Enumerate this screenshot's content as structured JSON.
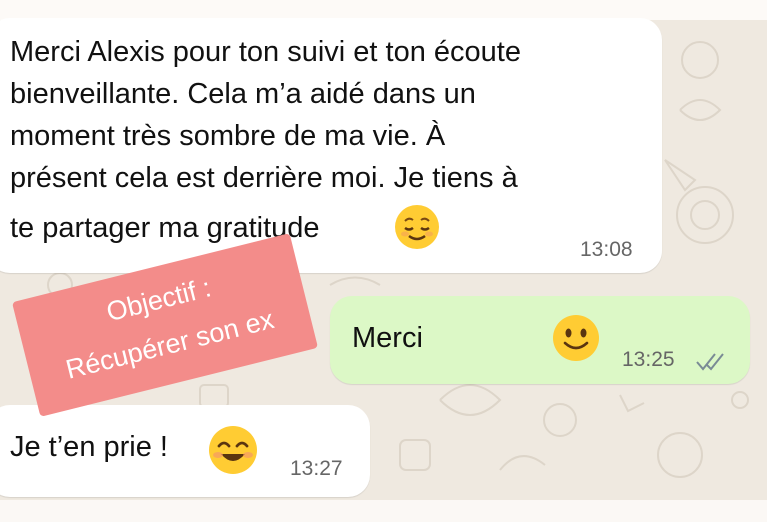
{
  "colors": {
    "background": "#efe9e0",
    "incoming_bubble": "#ffffff",
    "outgoing_bubble": "#dcf8c6",
    "sticker": "#f38c8a",
    "read_ticks": "#7a8b95"
  },
  "messages": [
    {
      "direction": "incoming",
      "lines": [
        "Merci Alexis pour ton suivi et ton écoute",
        "bienveillante. Cela m’a aidé dans un",
        "moment très sombre de ma vie. À",
        "présent cela est derrière moi. Je tiens à",
        "te partager ma gratitude"
      ],
      "emoji": "relieved-face-emoji",
      "time": "13:08"
    },
    {
      "direction": "outgoing",
      "text": "Merci",
      "emoji": "slightly-smiling-face-emoji",
      "time": "13:25",
      "status": "read-double-check"
    },
    {
      "direction": "incoming",
      "text": "Je t’en prie !",
      "emoji": "smiling-face-with-smiling-eyes-emoji",
      "time": "13:27"
    }
  ],
  "sticker": {
    "line1": "Objectif :",
    "line2": "Récupérer son ex"
  }
}
